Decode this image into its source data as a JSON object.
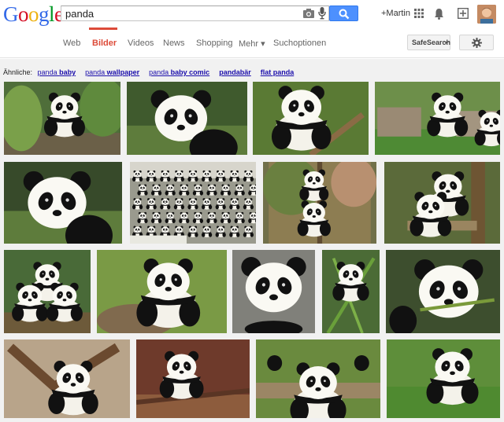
{
  "header": {
    "logo_letters": [
      {
        "ch": "G",
        "color": "#3369e8"
      },
      {
        "ch": "o",
        "color": "#d50f25"
      },
      {
        "ch": "o",
        "color": "#eeb211"
      },
      {
        "ch": "g",
        "color": "#3369e8"
      },
      {
        "ch": "l",
        "color": "#009925"
      },
      {
        "ch": "e",
        "color": "#d50f25"
      }
    ],
    "search_query": "panda",
    "user_name": "+Martin",
    "icons": [
      "camera-icon",
      "microphone-icon",
      "search-icon",
      "apps-grid-icon",
      "notifications-bell-icon",
      "share-plus-icon"
    ]
  },
  "tabs": [
    {
      "label": "Web",
      "active": false
    },
    {
      "label": "Bilder",
      "active": true
    },
    {
      "label": "Videos",
      "active": false
    },
    {
      "label": "News",
      "active": false
    },
    {
      "label": "Shopping",
      "active": false
    },
    {
      "label": "Mehr ▾",
      "active": false
    },
    {
      "label": "Suchoptionen",
      "active": false
    }
  ],
  "safesearch_label": "SafeSearch",
  "related": {
    "label": "Ähnliche:",
    "items": [
      {
        "plain": "panda ",
        "bold": "baby"
      },
      {
        "plain": "panda ",
        "bold": "wallpaper"
      },
      {
        "plain": "panda ",
        "bold": "baby comic"
      },
      {
        "plain": "",
        "bold": "pandabär"
      },
      {
        "plain": "",
        "bold": "flat panda"
      }
    ]
  },
  "colors": {
    "accent_red": "#dd4b39",
    "search_blue": "#4d90fe",
    "link_blue": "#1a0dab",
    "panel_grey": "#f1f1f1"
  },
  "image_results": [
    {
      "kind": "panda-standing-foliage",
      "bg": "#4f6e3a"
    },
    {
      "kind": "panda-face-closeup",
      "bg": "#3f5a2d"
    },
    {
      "kind": "panda-cub-branch",
      "bg": "#5a7a34"
    },
    {
      "kind": "panda-on-stumps",
      "bg": "#6d8f4a"
    },
    {
      "kind": "panda-face-closeup",
      "bg": "#374a2a"
    },
    {
      "kind": "panda-sculptures-crowd",
      "bg": "#9a9a8e"
    },
    {
      "kind": "panda-climbing",
      "bg": "#71704a"
    },
    {
      "kind": "panda-cubs-tree",
      "bg": "#5b6a3a"
    },
    {
      "kind": "panda-cubs-group",
      "bg": "#496a38"
    },
    {
      "kind": "panda-on-log",
      "bg": "#7a9a45"
    },
    {
      "kind": "panda-cub-face",
      "bg": "#80807a"
    },
    {
      "kind": "panda-eating-bamboo",
      "bg": "#4b6b36"
    },
    {
      "kind": "panda-eating-closeup",
      "bg": "#3d4e2e"
    },
    {
      "kind": "panda-cub-playing",
      "bg": "#b8a48a"
    },
    {
      "kind": "panda-on-platform",
      "bg": "#6e3a2b"
    },
    {
      "kind": "panda-on-back",
      "bg": "#6a8a3e"
    },
    {
      "kind": "panda-sitting-grass",
      "bg": "#5e8e3a"
    }
  ]
}
